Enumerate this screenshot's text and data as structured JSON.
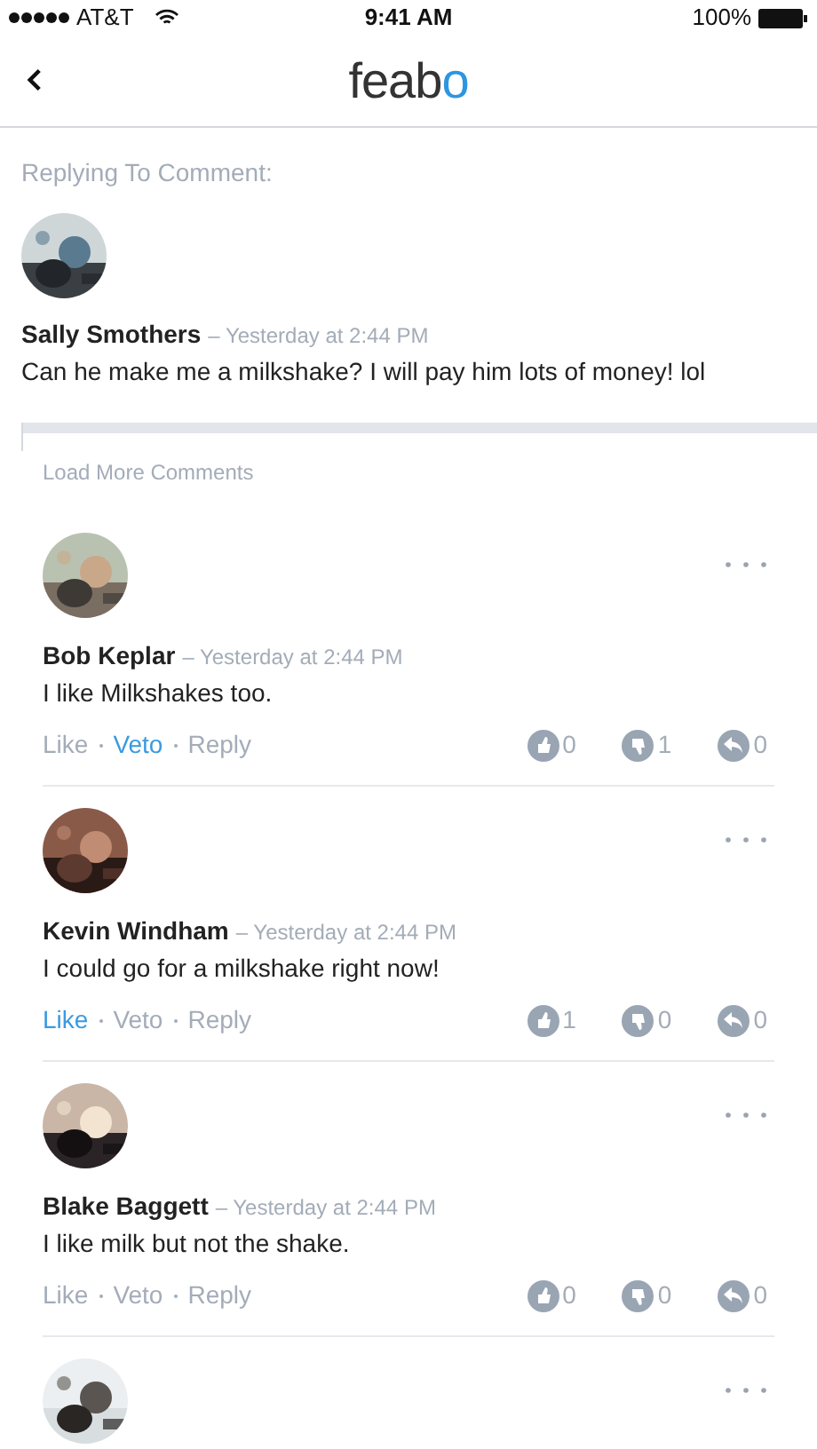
{
  "status_bar": {
    "carrier": "AT&T",
    "time": "9:41 AM",
    "battery": "100%"
  },
  "nav": {
    "logo": {
      "main": "feab",
      "accent": "o"
    }
  },
  "replying_label": "Replying To Comment:",
  "parent_comment": {
    "author": "Sally Smothers",
    "time": "– Yesterday at 2:44 PM",
    "text": "Can he make me a milkshake? I will pay him lots of money! lol"
  },
  "load_more": "Load More Comments",
  "comments": [
    {
      "author": "Bob Keplar",
      "time": "– Yesterday at 2:44 PM",
      "text": "I like Milkshakes too.",
      "actions": [
        {
          "label": "Like",
          "selected": false
        },
        {
          "label": "Veto",
          "selected": true
        },
        {
          "label": "Reply",
          "selected": false
        }
      ],
      "stats": [
        {
          "kind": "like",
          "count": "0"
        },
        {
          "kind": "veto",
          "count": "1"
        },
        {
          "kind": "reply",
          "count": "0"
        }
      ]
    },
    {
      "author": "Kevin Windham",
      "time": "– Yesterday at 2:44 PM",
      "text": "I could go for a milkshake right now!",
      "actions": [
        {
          "label": "Like",
          "selected": true
        },
        {
          "label": "Veto",
          "selected": false
        },
        {
          "label": "Reply",
          "selected": false
        }
      ],
      "stats": [
        {
          "kind": "like",
          "count": "1"
        },
        {
          "kind": "veto",
          "count": "0"
        },
        {
          "kind": "reply",
          "count": "0"
        }
      ]
    },
    {
      "author": "Blake Baggett",
      "time": "– Yesterday at 2:44 PM",
      "text": "I like milk but not the shake.",
      "actions": [
        {
          "label": "Like",
          "selected": false
        },
        {
          "label": "Veto",
          "selected": false
        },
        {
          "label": "Reply",
          "selected": false
        }
      ],
      "stats": [
        {
          "kind": "like",
          "count": "0"
        },
        {
          "kind": "veto",
          "count": "0"
        },
        {
          "kind": "reply",
          "count": "0"
        }
      ]
    },
    {
      "kind": "partial"
    }
  ]
}
